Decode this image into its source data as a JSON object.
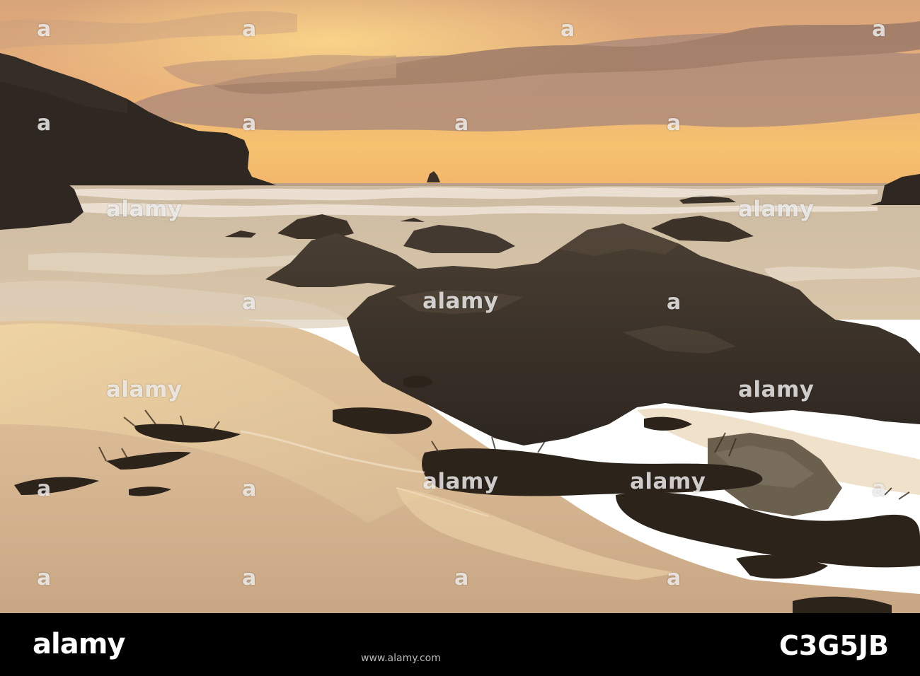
{
  "photo": {
    "subject": "sunset over sandy beach with seaweed-covered rocks, headland and sea stack",
    "watermark_text": "a",
    "watermark_word": "alamy",
    "palette": {
      "sky_top": "#e7b27c",
      "sky_glow": "#f7c46d",
      "cloud": "#9b7d6f",
      "sea": "#c7b7a0",
      "sand": "#d6b894",
      "rock": "#3a3128",
      "seaweed": "#2f261b"
    }
  },
  "footer": {
    "logo_text": "alamy",
    "image_id": "C3G5JB",
    "url_text": "www.alamy.com"
  }
}
